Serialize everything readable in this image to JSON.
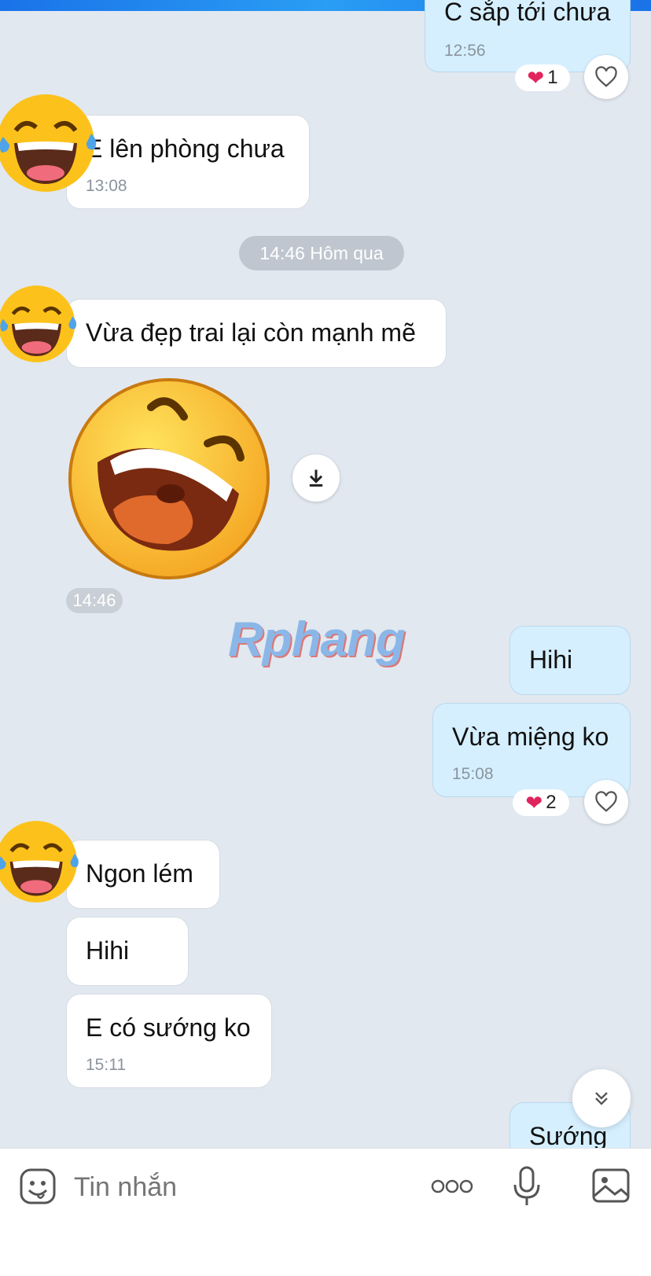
{
  "colors": {
    "outgoing_bubble": "#d5efff",
    "incoming_bubble": "#ffffff",
    "background": "#e2e8f0",
    "accent": "#1a73e8"
  },
  "messages": [
    {
      "text": "C sắp tới chưa",
      "time": "12:56",
      "reaction_count": "1"
    },
    {
      "text": "E lên phòng chưa",
      "time": "13:08"
    },
    {
      "text": "Vừa đẹp trai lại còn mạnh mẽ"
    },
    {
      "time": "14:46"
    },
    {
      "text": "Hihi"
    },
    {
      "text": "Vừa miệng ko",
      "time": "15:08",
      "reaction_count": "2"
    },
    {
      "text": "Ngon lém"
    },
    {
      "text": "Hihi"
    },
    {
      "text": "E có sướng ko",
      "time": "15:11"
    },
    {
      "text": "Sướng"
    }
  ],
  "date_separator": "14:46 Hôm qua",
  "watermark": "Rphang",
  "input": {
    "placeholder": "Tin nhắn"
  },
  "icons": [
    "sticker-icon",
    "more-icon",
    "microphone-icon",
    "image-icon",
    "download-icon",
    "scroll-down-icon",
    "heart-icon"
  ]
}
